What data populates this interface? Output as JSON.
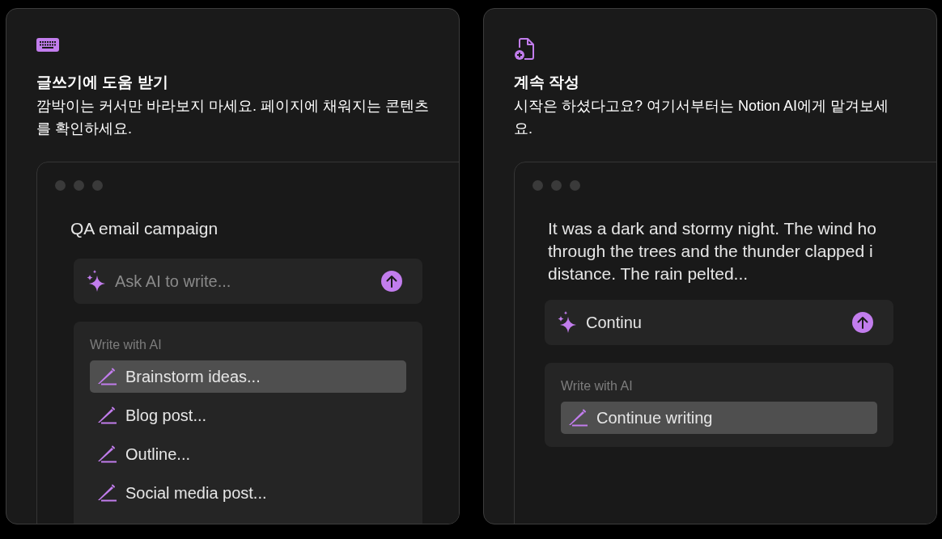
{
  "cards": [
    {
      "kind": "keyboard",
      "title": "글쓰기에 도움 받기",
      "description": "깜박이는 커서만 바라보지 마세요. 페이지에 채워지는 콘텐츠를 확인하세요.",
      "mock": {
        "heading": "QA email campaign",
        "input": {
          "placeholder": "Ask AI to write..."
        },
        "menu": {
          "header": "Write with AI",
          "items": [
            {
              "label": "Brainstorm ideas...",
              "selected": true
            },
            {
              "label": "Blog post...",
              "selected": false
            },
            {
              "label": "Outline...",
              "selected": false
            },
            {
              "label": "Social media post...",
              "selected": false
            }
          ]
        }
      }
    },
    {
      "kind": "file-plus",
      "title": "계속 작성",
      "description": "시작은 하셨다고요? 여기서부터는 Notion AI에게 맡겨보세요.",
      "mock": {
        "paragraph": [
          "It was a dark and stormy night. The wind ho",
          "through the trees and the thunder clapped i",
          "distance. The rain pelted..."
        ],
        "input": {
          "value": "Continu"
        },
        "menu": {
          "header": "Write with AI",
          "items": [
            {
              "label": "Continue writing",
              "selected": true
            }
          ]
        }
      }
    }
  ]
}
